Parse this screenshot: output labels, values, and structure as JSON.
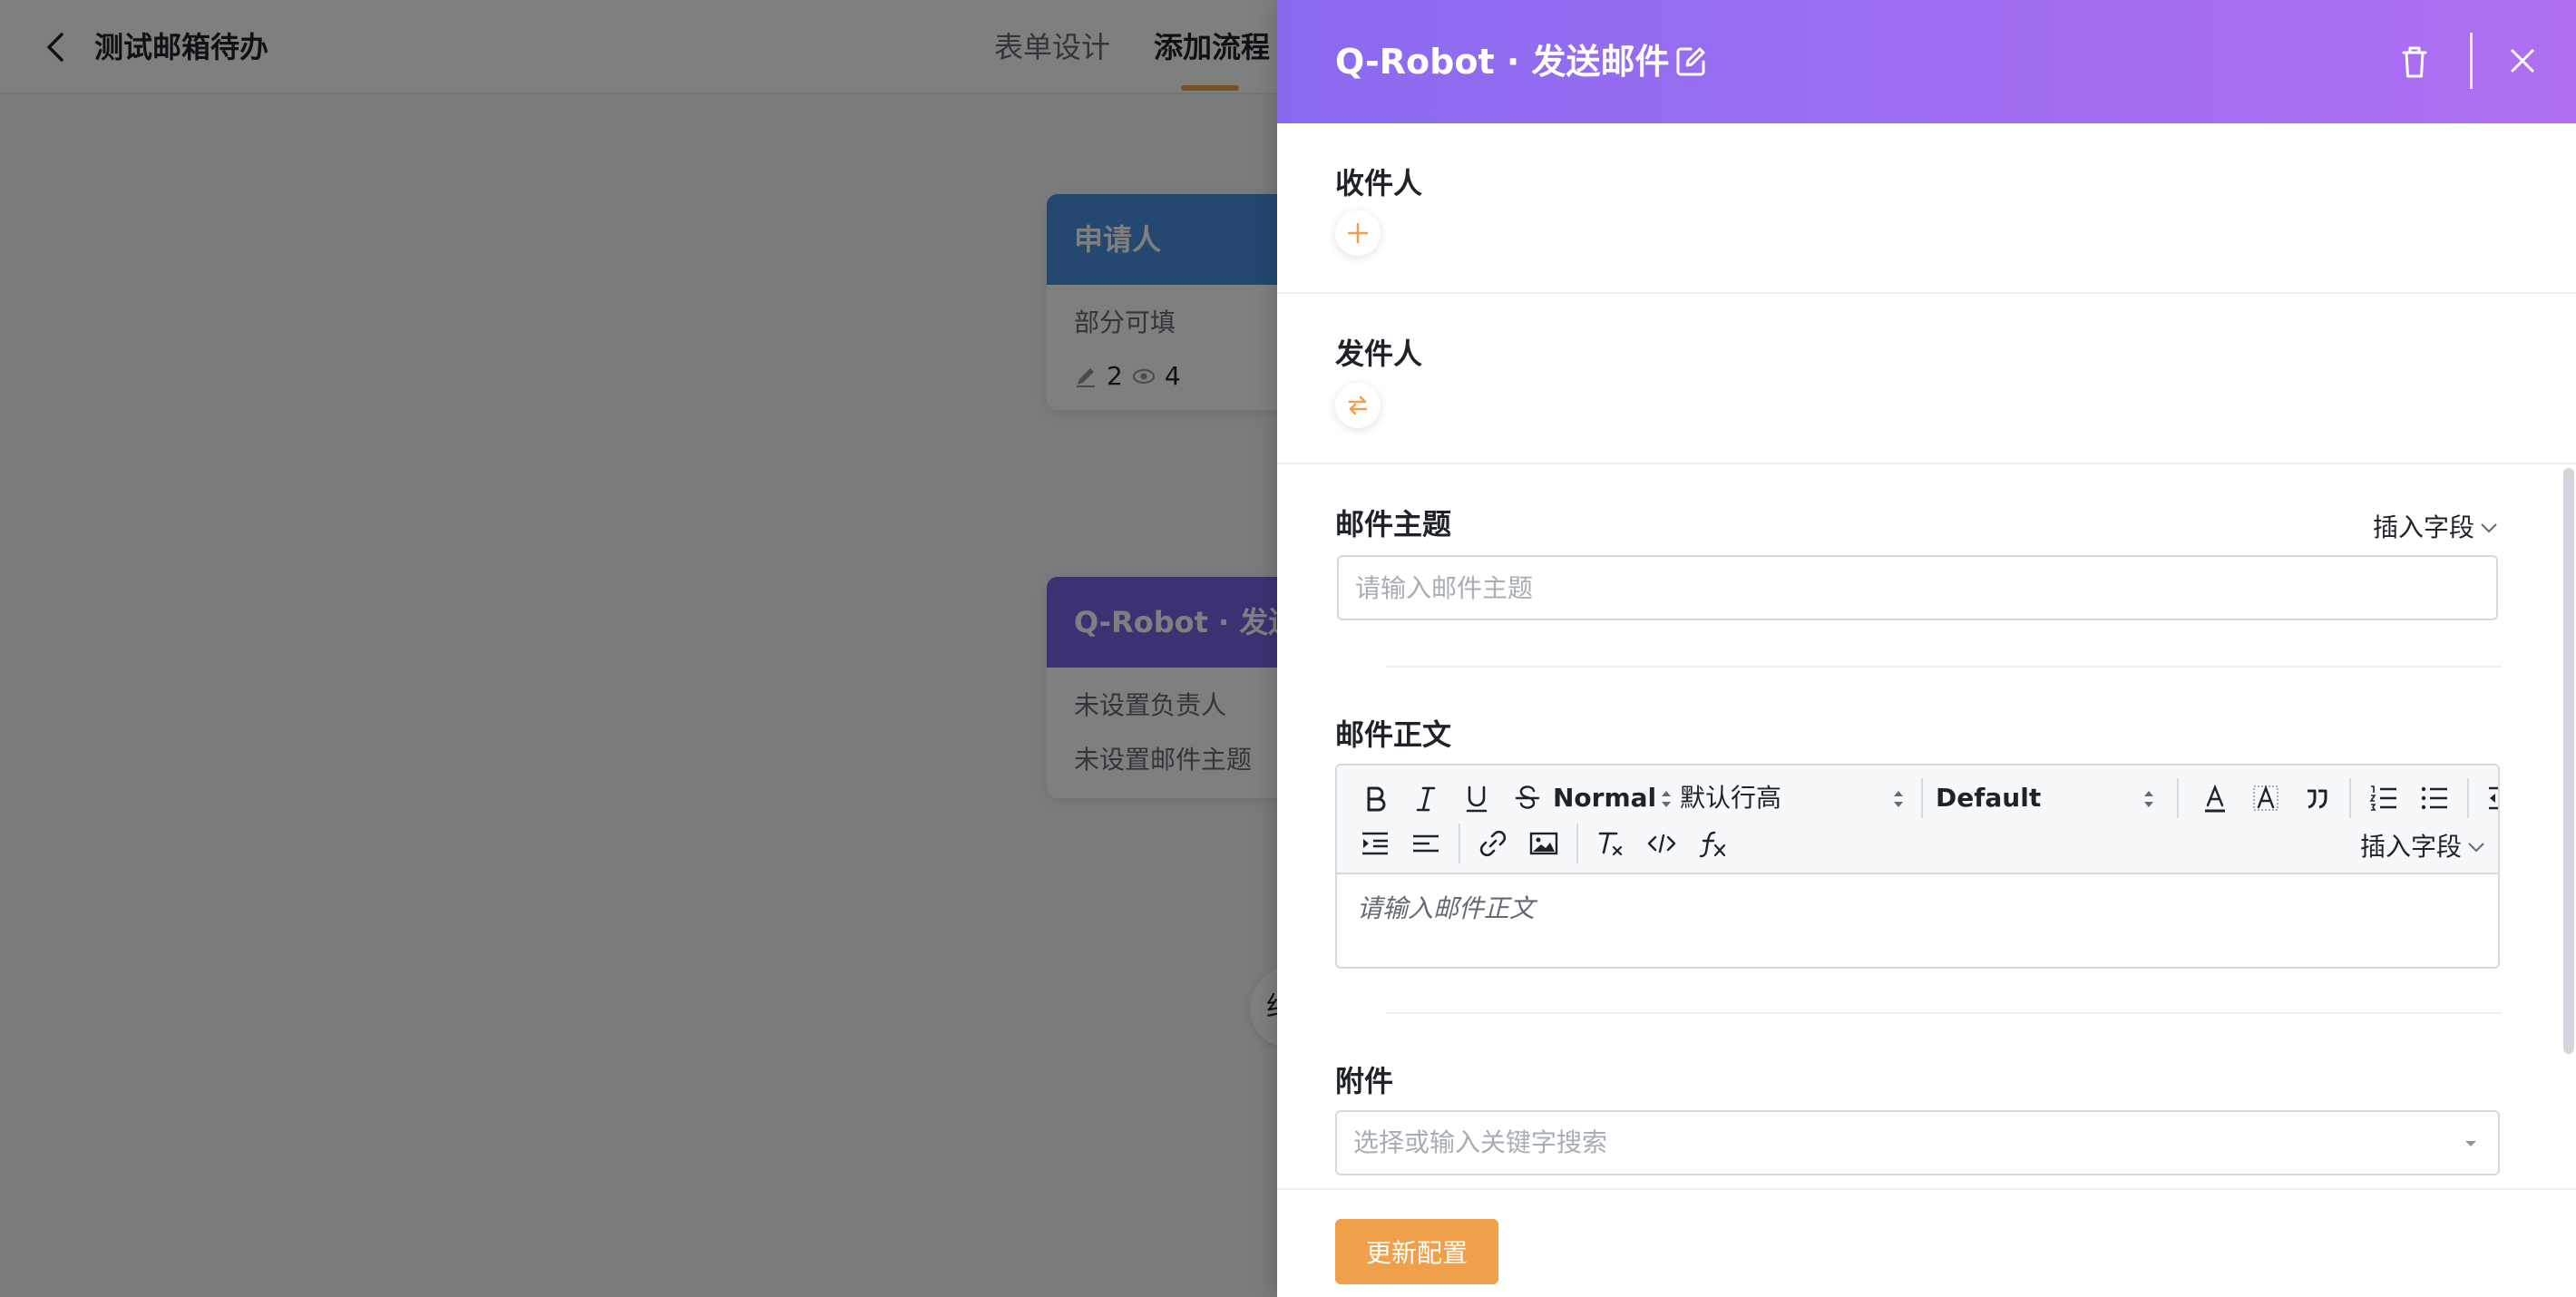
{
  "page": {
    "title": "测试邮箱待办",
    "tabs": [
      {
        "label": "表单设计",
        "active": false
      },
      {
        "label": "添加流程",
        "active": true
      }
    ],
    "accent_color": "#f0a04b"
  },
  "flow": {
    "applicant_node": {
      "title": "申请人",
      "line": "部分可填",
      "edit_count": "2",
      "view_count": "4"
    },
    "robot_node": {
      "title": "Q-Robot · 发送",
      "line1": "未设置负责人",
      "line2": "未设置邮件主题"
    },
    "add_button_glyph": "约"
  },
  "drawer": {
    "title": "Q-Robot · 发送邮件",
    "header_gradient": [
      "#8a6bf0",
      "#b06ff2"
    ],
    "recipient": {
      "label": "收件人",
      "add_icon": "plus-icon"
    },
    "sender": {
      "label": "发件人",
      "toggle_icon": "swap-icon"
    },
    "subject": {
      "label": "邮件主题",
      "insert_field_label": "插入字段",
      "placeholder": "请输入邮件主题",
      "value": ""
    },
    "body": {
      "label": "邮件正文",
      "insert_field_label": "插入字段",
      "placeholder": "请输入邮件正文",
      "toolbar": {
        "size_select": "Normal",
        "line_height_select": "默认行高",
        "font_select": "Default",
        "buttons": [
          "bold",
          "italic",
          "underline",
          "strike",
          "font-color",
          "background-color",
          "blockquote",
          "ordered-list",
          "bullet-list",
          "outdent",
          "indent",
          "align",
          "link",
          "image",
          "clean",
          "code",
          "formula"
        ]
      }
    },
    "attachment": {
      "label": "附件",
      "placeholder": "选择或输入关键字搜索"
    },
    "footer": {
      "submit_label": "更新配置"
    }
  }
}
